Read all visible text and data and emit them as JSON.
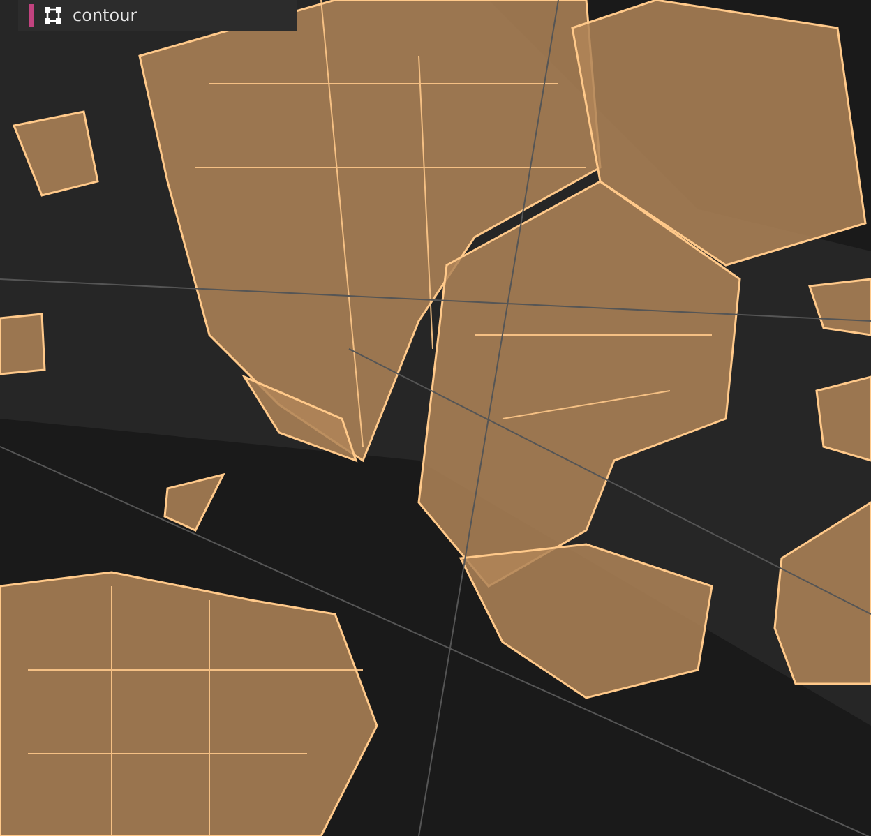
{
  "layer_panel": {
    "label": "contour",
    "color": "#c2437f"
  }
}
